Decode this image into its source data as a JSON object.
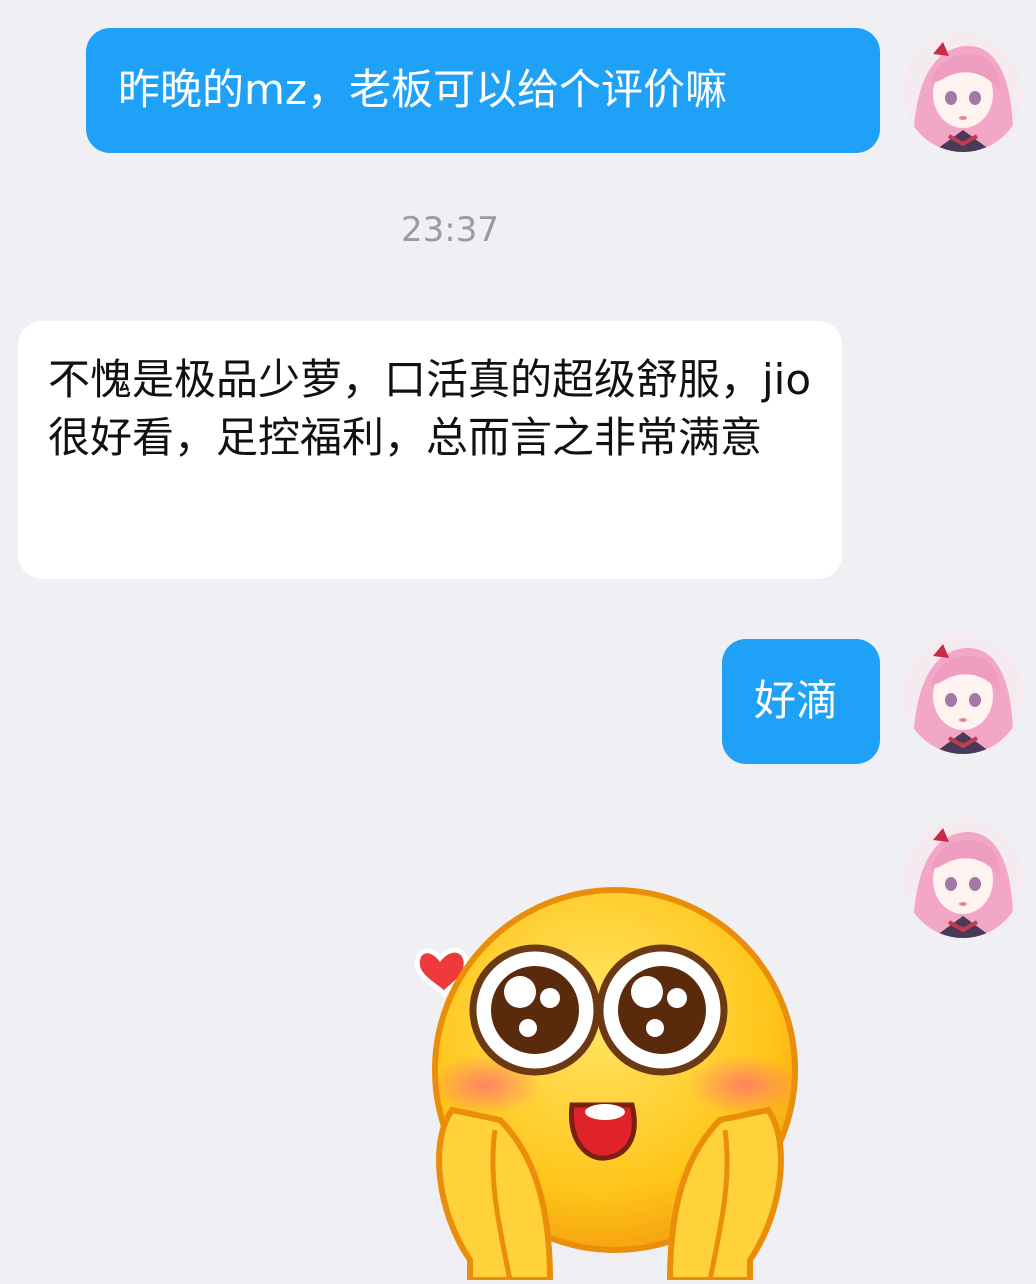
{
  "conversation": {
    "messages": [
      {
        "direction": "outgoing",
        "type": "text",
        "text": "昨晚的mz，老板可以给个评价嘛"
      },
      {
        "direction": "system",
        "type": "timestamp",
        "text": "23:37"
      },
      {
        "direction": "incoming",
        "type": "text",
        "text": "不愧是极品少萝，口活真的超级舒服，jio很好看，足控福利，总而言之非常满意"
      },
      {
        "direction": "outgoing",
        "type": "text",
        "text": "好滴"
      },
      {
        "direction": "outgoing",
        "type": "sticker",
        "sticker": "blushing-shy-face-with-heart"
      }
    ],
    "avatar": {
      "description": "pink-haired-anime-girl-avatar"
    }
  },
  "colors": {
    "background": "#efeff4",
    "outgoing_bubble": "#1ea1f7",
    "incoming_bubble": "#ffffff",
    "timestamp_text": "#9a9aa0"
  }
}
